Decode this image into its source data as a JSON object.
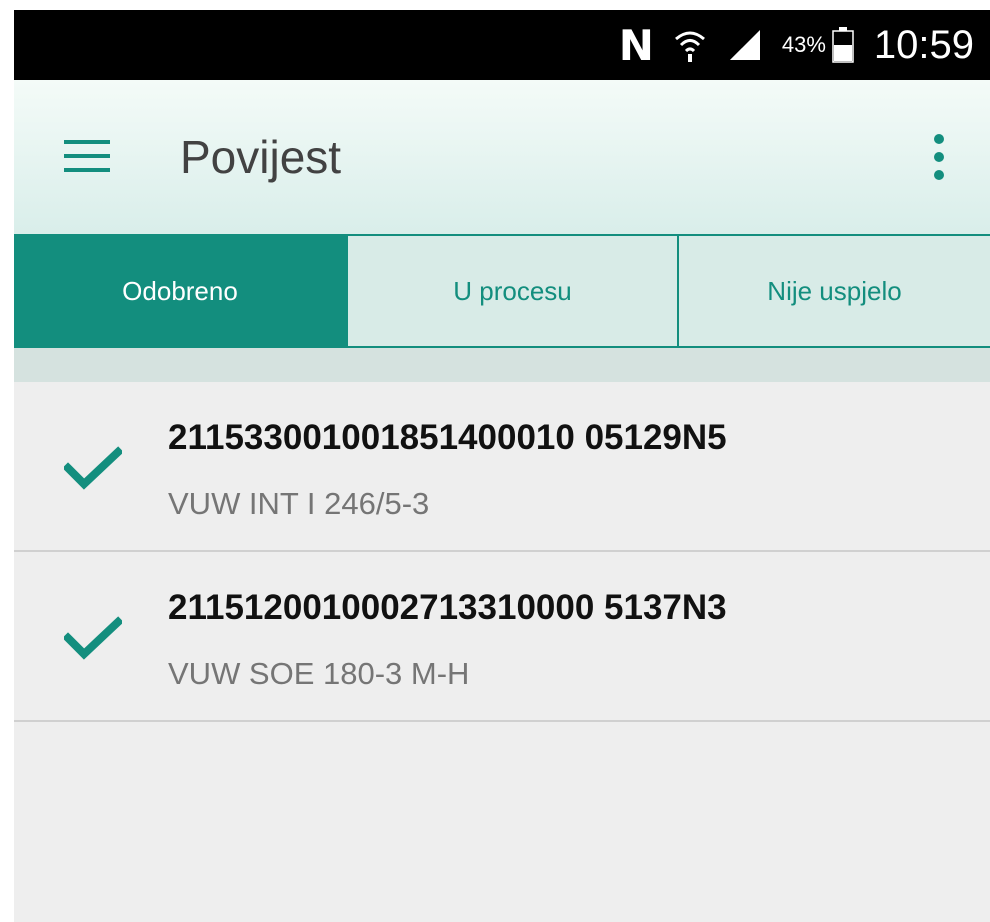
{
  "status_bar": {
    "nfc_icon": "N",
    "battery_percent": "43%",
    "time": "10:59"
  },
  "app_bar": {
    "title": "Povijest",
    "menu_icon": "hamburger-menu-icon",
    "overflow_icon": "more-vert-icon"
  },
  "tabs": [
    {
      "label": "Odobreno",
      "active": true
    },
    {
      "label": "U procesu",
      "active": false
    },
    {
      "label": "Nije uspjelo",
      "active": false
    }
  ],
  "list": {
    "items": [
      {
        "title": "211533001001851400010 05129N5",
        "subtitle": "VUW INT I 246/5-3",
        "icon": "check-icon"
      },
      {
        "title": "2115120010002713310000 5137N3",
        "subtitle": "VUW SOE 180-3 M-H",
        "icon": "check-icon"
      }
    ]
  },
  "colors": {
    "accent": "#138e7e",
    "status_bar": "#000000",
    "background": "#eeeeee"
  }
}
